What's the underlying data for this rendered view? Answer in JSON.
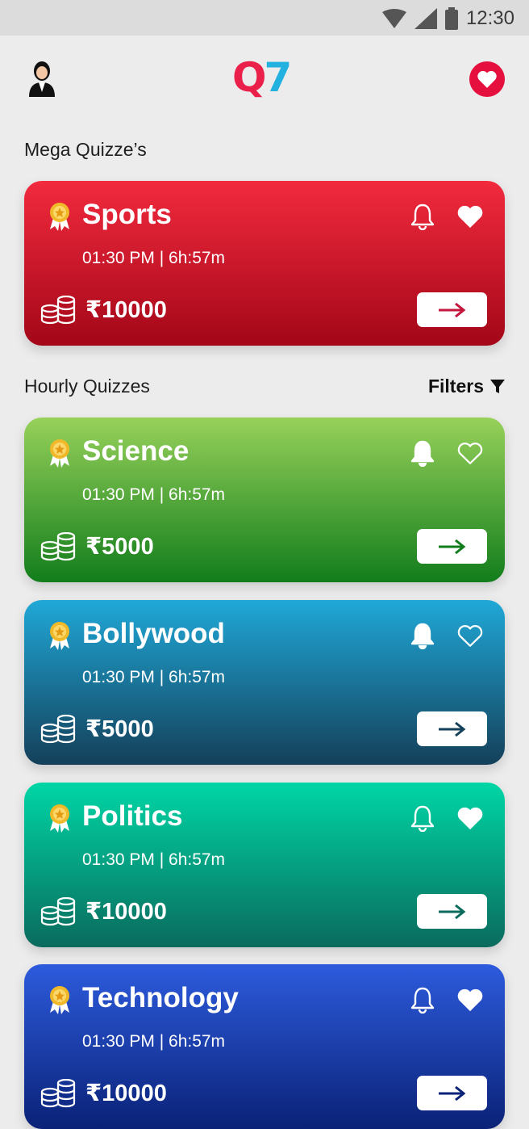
{
  "status_bar": {
    "time": "12:30",
    "icons": [
      "wifi-icon",
      "signal-icon",
      "battery-icon"
    ]
  },
  "app_bar": {
    "logo_left": "Q",
    "logo_right": "7",
    "left_icon": "user-avatar-icon",
    "right_icon": "heart-icon"
  },
  "sections": {
    "mega": "Mega Quizze’s",
    "hourly": "Hourly Quizzes",
    "filters": "Filters"
  },
  "cards": [
    {
      "title": "Sports",
      "time": "01:30 PM  |  6h:57m",
      "prize": "₹10000",
      "bell": "outline",
      "favorite": true,
      "arrow_color": "#c4153c"
    },
    {
      "title": "Science",
      "time": "01:30 PM  |  6h:57m",
      "prize": "₹5000",
      "bell": "filled",
      "favorite": false,
      "arrow_color": "#127d1c"
    },
    {
      "title": "Bollywood",
      "time": "01:30 PM  |  6h:57m",
      "prize": "₹5000",
      "bell": "filled",
      "favorite": false,
      "arrow_color": "#14405a"
    },
    {
      "title": "Politics",
      "time": "01:30 PM  |  6h:57m",
      "prize": "₹10000",
      "bell": "outline",
      "favorite": true,
      "arrow_color": "#0a6b5d"
    },
    {
      "title": "Technology",
      "time": "01:30 PM  |  6h:57m",
      "prize": "₹10000",
      "bell": "outline",
      "favorite": true,
      "arrow_color": "#0a2277"
    }
  ],
  "colors": {
    "brand_red": "#e5103e",
    "brand_blue": "#23b1df",
    "background": "#ececec"
  }
}
